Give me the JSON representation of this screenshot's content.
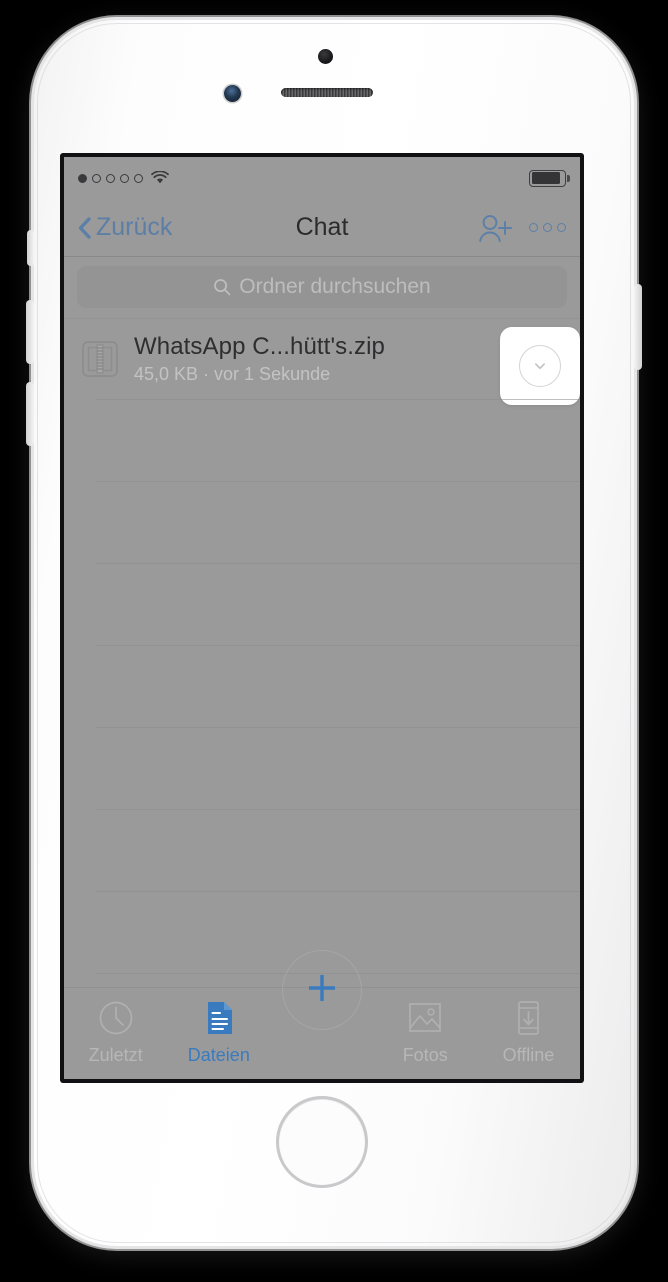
{
  "device": {
    "name": "iphone-white",
    "camera_icon": "front-camera",
    "speaker_icon": "earpiece-speaker",
    "sensor_icon": "proximity-sensor",
    "home_button": "home-button"
  },
  "status_bar": {
    "signal_dots_total": 5,
    "signal_dots_filled": 1,
    "wifi_icon": "wifi-icon",
    "battery_icon": "battery-icon",
    "battery_level_percent": 90
  },
  "nav_bar": {
    "back_label": "Zurück",
    "back_icon": "chevron-left-icon",
    "title": "Chat",
    "add_user_icon": "add-user-icon",
    "more_icon": "more-options-icon",
    "tint_color": "#5b7fa6"
  },
  "search": {
    "placeholder": "Ordner durchsuchen",
    "value": "",
    "icon": "search-icon"
  },
  "files": {
    "rows": [
      {
        "icon": "zip-file-icon",
        "name": "WhatsApp C...hütt's.zip",
        "meta": "45,0 KB · vor 1 Sekunde",
        "action_icon": "chevron-down-circle-icon",
        "highlighted": true
      }
    ],
    "empty_rows": 7
  },
  "tab_bar": {
    "items": [
      {
        "label": "Zuletzt",
        "icon": "clock-icon",
        "active": false
      },
      {
        "label": "Dateien",
        "icon": "document-icon",
        "active": true
      },
      {
        "label": "",
        "icon": "plus-icon",
        "active": false
      },
      {
        "label": "Fotos",
        "icon": "photo-icon",
        "active": false
      },
      {
        "label": "Offline",
        "icon": "device-download-icon",
        "active": false
      }
    ],
    "active_color": "#3a7bbf",
    "inactive_color": "#b7b7b7"
  },
  "colors": {
    "screen_background": "#9a9a9a",
    "search_background": "#949494",
    "highlight_background": "#ffffff",
    "accent_blue": "#3a7bbf"
  }
}
